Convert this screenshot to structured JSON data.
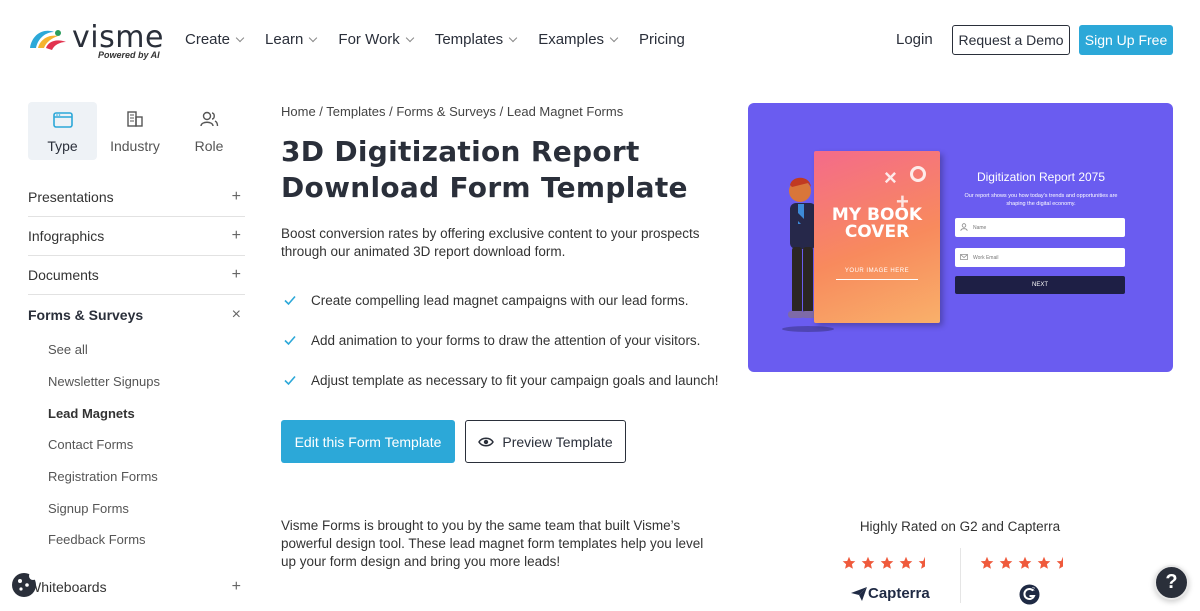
{
  "header": {
    "logo_word": "visme",
    "logo_sub": "Powered by AI",
    "nav": [
      {
        "label": "Create",
        "dropdown": true
      },
      {
        "label": "Learn",
        "dropdown": true
      },
      {
        "label": "For Work",
        "dropdown": true
      },
      {
        "label": "Templates",
        "dropdown": true
      },
      {
        "label": "Examples",
        "dropdown": true
      },
      {
        "label": "Pricing",
        "dropdown": false
      }
    ],
    "login_label": "Login",
    "demo_label": "Request a Demo",
    "signup_label": "Sign Up Free"
  },
  "sidebar": {
    "filter_tabs": [
      {
        "label": "Type",
        "icon": "window-icon",
        "active": true
      },
      {
        "label": "Industry",
        "icon": "buildings-icon",
        "active": false
      },
      {
        "label": "Role",
        "icon": "people-icon",
        "active": false
      }
    ],
    "categories": [
      {
        "label": "Presentations",
        "toggle": "+"
      },
      {
        "label": "Infographics",
        "toggle": "+"
      },
      {
        "label": "Documents",
        "toggle": "+"
      },
      {
        "label": "Forms & Surveys",
        "toggle": "×"
      }
    ],
    "subcategories": [
      {
        "label": "See all",
        "active": false
      },
      {
        "label": "Newsletter Signups",
        "active": false
      },
      {
        "label": "Lead Magnets",
        "active": true
      },
      {
        "label": "Contact Forms",
        "active": false
      },
      {
        "label": "Registration Forms",
        "active": false
      },
      {
        "label": "Signup Forms",
        "active": false
      },
      {
        "label": "Feedback Forms",
        "active": false
      }
    ],
    "last_category": {
      "label": "Whiteboards",
      "toggle": "+"
    }
  },
  "main": {
    "breadcrumb": "Home / Templates / Forms & Surveys / Lead Magnet Forms",
    "title": "3D Digitization Report Download Form Template",
    "description": "Boost conversion rates by offering exclusive content to your prospects through our animated 3D report download form.",
    "bullets": [
      "Create compelling lead magnet campaigns with our lead forms.",
      "Add animation to your forms to draw the attention of your visitors.",
      "Adjust template as necessary to fit your campaign goals and launch!"
    ],
    "edit_button": "Edit this Form Template",
    "preview_button": "Preview Template",
    "intro": "Visme Forms is brought to you by the same team that built Visme’s powerful design tool. These lead magnet form templates help you level up your form design and bring you more leads!"
  },
  "preview": {
    "book_title": "MY BOOK COVER",
    "book_subtitle": "YOUR IMAGE HERE",
    "form_title": "Digitization Report 2075",
    "form_text": "Our report shows you how today's trends and opportunities are shaping the digital economy.",
    "name_placeholder": "Name",
    "email_placeholder": "Work Email",
    "next_label": "NEXT",
    "bg_color": "#6a5cf0"
  },
  "ratings": {
    "heading": "Highly Rated on G2 and Capterra",
    "capterra_stars": 4.5,
    "g2_stars": 4.5,
    "capterra_label": "Capterra",
    "star_color": "#ef5a3c"
  },
  "help_label": "?"
}
